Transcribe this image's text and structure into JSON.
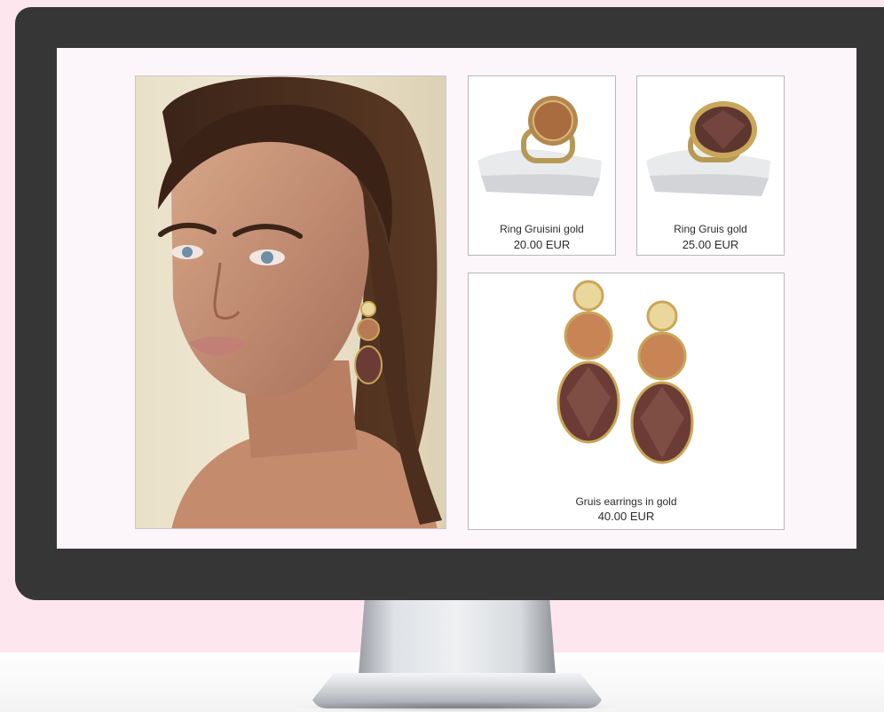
{
  "products": [
    {
      "name": "Ring Gruisini gold",
      "price": "20.00 EUR"
    },
    {
      "name": "Ring Gruis gold",
      "price": "25.00 EUR"
    },
    {
      "name": "Gruis earrings in gold",
      "price": "40.00 EUR"
    }
  ],
  "colors": {
    "background": "#fde6ee",
    "monitor_bezel": "#363636",
    "screen": "#fcf5f9",
    "card_border": "#b9b9b9",
    "gold": "#c9a659",
    "amber_gem": "#b87a56",
    "smoky_gem": "#6b3c35",
    "citrine": "#ead79b"
  }
}
